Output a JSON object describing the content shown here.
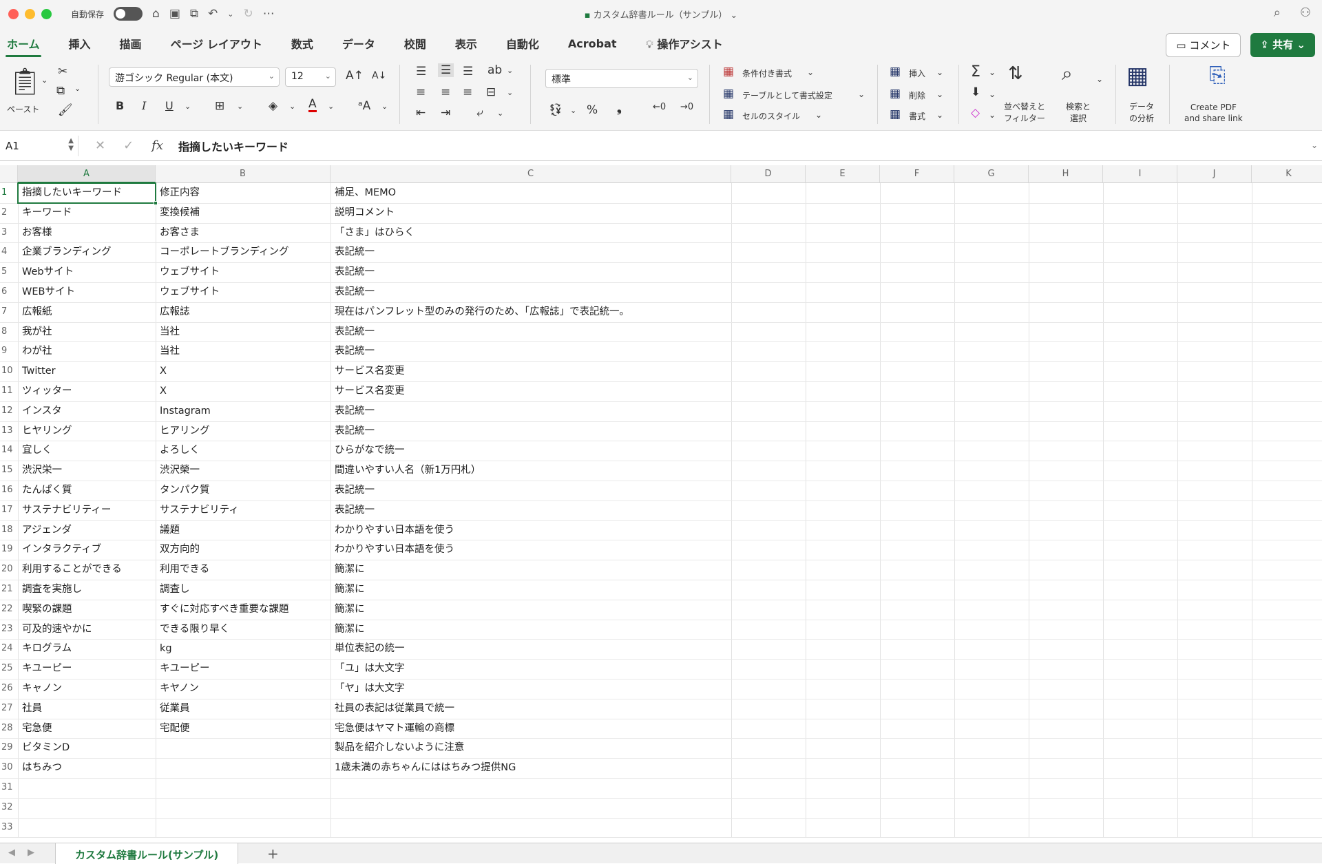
{
  "app": {
    "autosave_label": "自動保存",
    "doc_title": "カスタム辞書ルール（サンプル）",
    "title_chevron": "⌄"
  },
  "menu": {
    "tabs": [
      "ホーム",
      "挿入",
      "描画",
      "ページ レイアウト",
      "数式",
      "データ",
      "校閲",
      "表示",
      "自動化",
      "Acrobat",
      "操作アシスト"
    ],
    "comment_label": "コメント",
    "share_label": "共有"
  },
  "ribbon": {
    "paste_label": "ペースト",
    "font_name": "游ゴシック Regular (本文)",
    "font_size": "12",
    "number_format": "標準",
    "bold": "B",
    "italic": "I",
    "underline": "U",
    "percent": "%",
    "comma": "❟",
    "inc_font": "A↑",
    "dec_font": "A↓",
    "cond_format": "条件付き書式",
    "format_table": "テーブルとして書式設定",
    "cell_styles": "セルのスタイル",
    "insert": "挿入",
    "delete": "削除",
    "format": "書式",
    "sort_filter": "並べ替えと\nフィルター",
    "find_select": "検索と\n選択",
    "data_analysis": "データ\nの分析",
    "create_pdf": "Create PDF\nand share link"
  },
  "formula_bar": {
    "name_box": "A1",
    "fx": "fx",
    "value": "指摘したいキーワード"
  },
  "columns": [
    "A",
    "B",
    "C",
    "D",
    "E",
    "F",
    "G",
    "H",
    "I",
    "J",
    "K"
  ],
  "rows": [
    [
      "指摘したいキーワード",
      "修正内容",
      "補足、MEMO"
    ],
    [
      "キーワード",
      "変換候補",
      "説明コメント"
    ],
    [
      "お客様",
      "お客さま",
      "「さま」はひらく"
    ],
    [
      "企業ブランディング",
      "コーポレートブランディング",
      "表記統一"
    ],
    [
      "Webサイト",
      "ウェブサイト",
      "表記統一"
    ],
    [
      "WEBサイト",
      "ウェブサイト",
      "表記統一"
    ],
    [
      "広報紙",
      "広報誌",
      "現在はパンフレット型のみの発行のため、「広報誌」で表記統一。"
    ],
    [
      "我が社",
      "当社",
      "表記統一"
    ],
    [
      "わが社",
      "当社",
      "表記統一"
    ],
    [
      "Twitter",
      "X",
      "サービス名変更"
    ],
    [
      "ツィッター",
      "X",
      "サービス名変更"
    ],
    [
      "インスタ",
      "Instagram",
      "表記統一"
    ],
    [
      "ヒヤリング",
      "ヒアリング",
      "表記統一"
    ],
    [
      "宜しく",
      "よろしく",
      "ひらがなで統一"
    ],
    [
      "渋沢栄一",
      "渋沢榮一",
      "間違いやすい人名（新1万円札）"
    ],
    [
      "たんぱく質",
      "タンパク質",
      "表記統一"
    ],
    [
      "サステナビリティー",
      "サステナビリティ",
      "表記統一"
    ],
    [
      "アジェンダ",
      "議題",
      "わかりやすい日本語を使う"
    ],
    [
      "インタラクティブ",
      "双方向的",
      "わかりやすい日本語を使う"
    ],
    [
      "利用することができる",
      "利用できる",
      "簡潔に"
    ],
    [
      "調査を実施し",
      "調査し",
      "簡潔に"
    ],
    [
      "喫緊の課題",
      "すぐに対応すべき重要な課題",
      "簡潔に"
    ],
    [
      "可及的速やかに",
      "できる限り早く",
      "簡潔に"
    ],
    [
      "キログラム",
      "kg",
      "単位表記の統一"
    ],
    [
      "キユーピー",
      "キユーピー",
      "「ユ」は大文字"
    ],
    [
      "キャノン",
      "キヤノン",
      "「ヤ」は大文字"
    ],
    [
      "社員",
      "従業員",
      "社員の表記は従業員で統一"
    ],
    [
      "宅急便",
      "宅配便",
      "宅急便はヤマト運輸の商標"
    ],
    [
      "ビタミンD",
      "",
      "製品を紹介しないように注意"
    ],
    [
      "はちみつ",
      "",
      "1歳未満の赤ちゃんにははちみつ提供NG"
    ],
    [
      "",
      "",
      ""
    ],
    [
      "",
      "",
      ""
    ],
    [
      "",
      "",
      ""
    ]
  ],
  "sheet": {
    "tab_name": "カスタム辞書ルール(サンプル)",
    "add": "+"
  },
  "colors": {
    "accent": "#1f7a3f"
  }
}
